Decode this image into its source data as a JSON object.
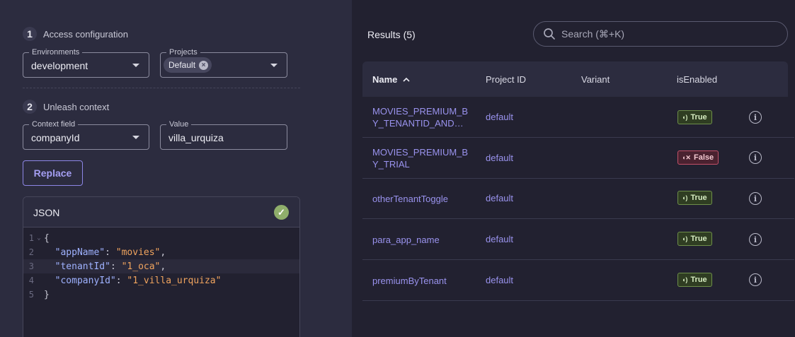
{
  "left": {
    "step1": {
      "num": "1",
      "label": "Access configuration"
    },
    "environments": {
      "label": "Environments",
      "value": "development"
    },
    "projects": {
      "label": "Projects",
      "chip": "Default"
    },
    "step2": {
      "num": "2",
      "label": "Unleash context"
    },
    "context_field": {
      "label": "Context field",
      "value": "companyId"
    },
    "value_field": {
      "label": "Value",
      "value": "villa_urquiza"
    },
    "replace_label": "Replace",
    "json": {
      "title": "JSON",
      "lines": [
        {
          "n": "1",
          "open": "{"
        },
        {
          "n": "2",
          "key": "\"appName\"",
          "val": "\"movies\"",
          "comma": ","
        },
        {
          "n": "3",
          "key": "\"tenantId\"",
          "val": "\"1_oca\"",
          "comma": ","
        },
        {
          "n": "4",
          "key": "\"companyId\"",
          "val": "\"1_villa_urquiza\"",
          "comma": ""
        },
        {
          "n": "5",
          "close": "}"
        }
      ]
    }
  },
  "results": {
    "title": "Results (5)",
    "search_placeholder": "Search (⌘+K)",
    "columns": {
      "name": "Name",
      "project": "Project ID",
      "variant": "Variant",
      "enabled": "isEnabled"
    },
    "rows": [
      {
        "name_line1": "MOVIES_PREMIUM_B",
        "name_line2": "Y_TENANTID_AND…",
        "project": "default",
        "variant": "",
        "enabled": "True"
      },
      {
        "name_line1": "MOVIES_PREMIUM_B",
        "name_line2": "Y_TRIAL",
        "project": "default",
        "variant": "",
        "enabled": "False"
      },
      {
        "name_line1": "otherTenantToggle",
        "name_line2": "",
        "project": "default",
        "variant": "",
        "enabled": "True"
      },
      {
        "name_line1": "para_app_name",
        "name_line2": "",
        "project": "default",
        "variant": "",
        "enabled": "True"
      },
      {
        "name_line1": "premiumByTenant",
        "name_line2": "",
        "project": "default",
        "variant": "",
        "enabled": "True"
      }
    ]
  },
  "colors": {
    "accent": "#9a93ee",
    "true": "#6e8f4a",
    "false": "#c45068"
  },
  "icons": {
    "search": "search-icon",
    "sort": "sort-asc-icon",
    "info": "info-icon",
    "check": "check-icon"
  }
}
